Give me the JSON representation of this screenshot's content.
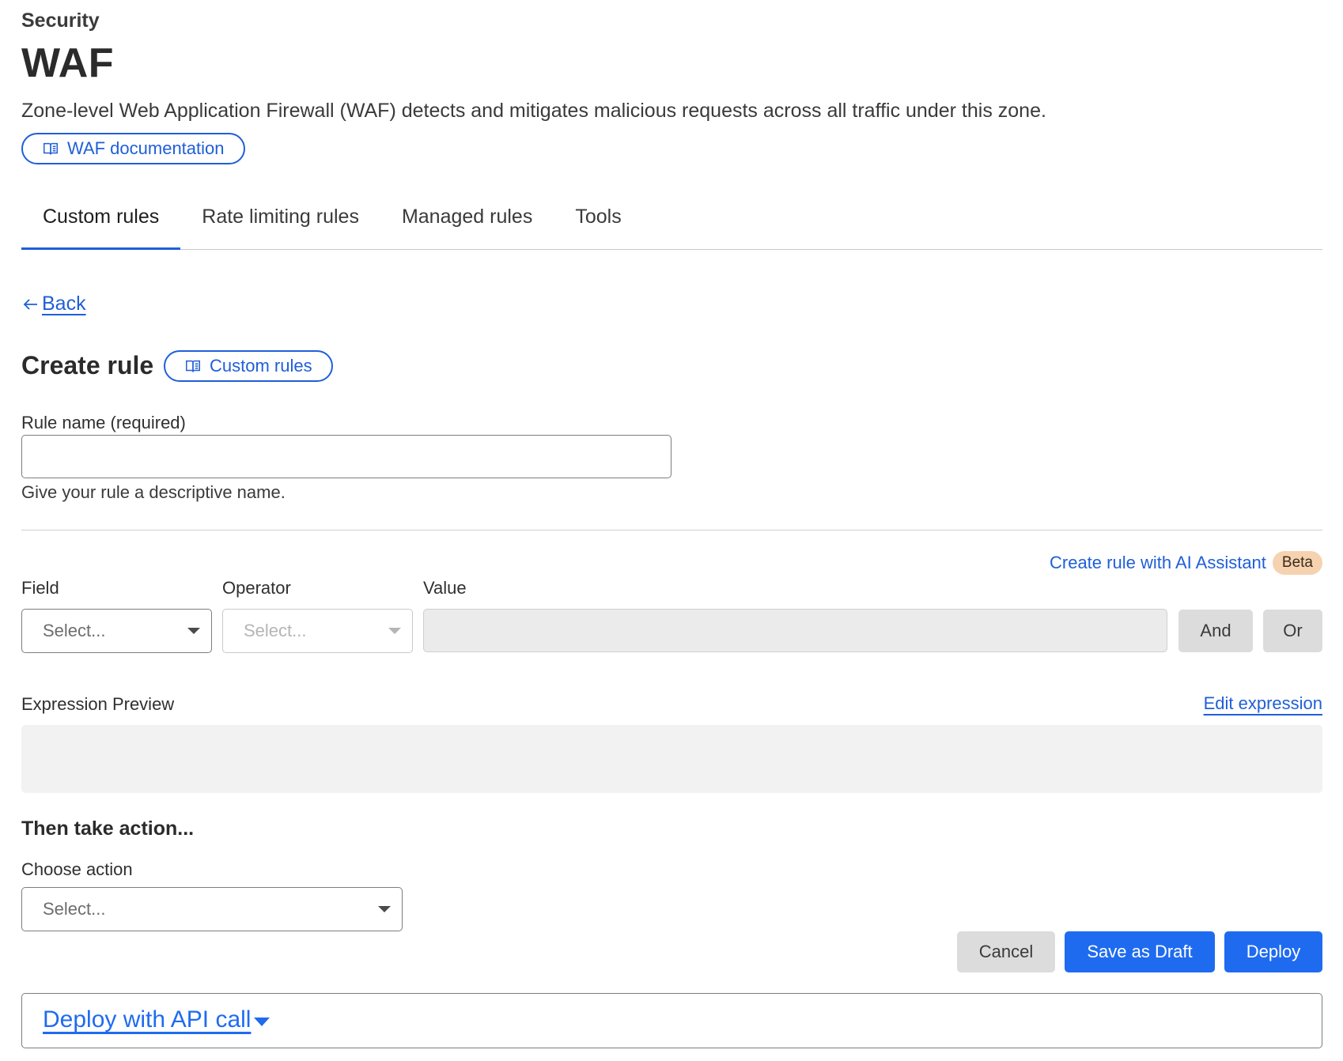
{
  "header": {
    "eyebrow": "Security",
    "title": "WAF",
    "description": "Zone-level Web Application Firewall (WAF) detects and mitigates malicious requests across all traffic under this zone.",
    "doc_link": "WAF documentation"
  },
  "tabs": [
    {
      "label": "Custom rules",
      "active": true
    },
    {
      "label": "Rate limiting rules",
      "active": false
    },
    {
      "label": "Managed rules",
      "active": false
    },
    {
      "label": "Tools",
      "active": false
    }
  ],
  "back": {
    "label": "Back"
  },
  "create_rule": {
    "title": "Create rule",
    "doc_link": "Custom rules",
    "rule_name_label": "Rule name (required)",
    "rule_name_value": "",
    "rule_name_help": "Give your rule a descriptive name."
  },
  "expression_builder": {
    "ai_link": "Create rule with AI Assistant",
    "ai_badge": "Beta",
    "field_label": "Field",
    "field_value": "Select...",
    "operator_label": "Operator",
    "operator_value": "Select...",
    "value_label": "Value",
    "and_label": "And",
    "or_label": "Or",
    "preview_label": "Expression Preview",
    "edit_link": "Edit expression"
  },
  "action": {
    "heading": "Then take action...",
    "choose_label": "Choose action",
    "choose_value": "Select..."
  },
  "footer_buttons": {
    "cancel": "Cancel",
    "save_draft": "Save as Draft",
    "deploy": "Deploy"
  },
  "api": {
    "label": "Deploy with API call"
  },
  "colors": {
    "accent": "#1f5fd8",
    "primary_button": "#1f6bf0",
    "beta_badge": "#f6d2b0",
    "secondary_button": "#dcdcdc"
  }
}
